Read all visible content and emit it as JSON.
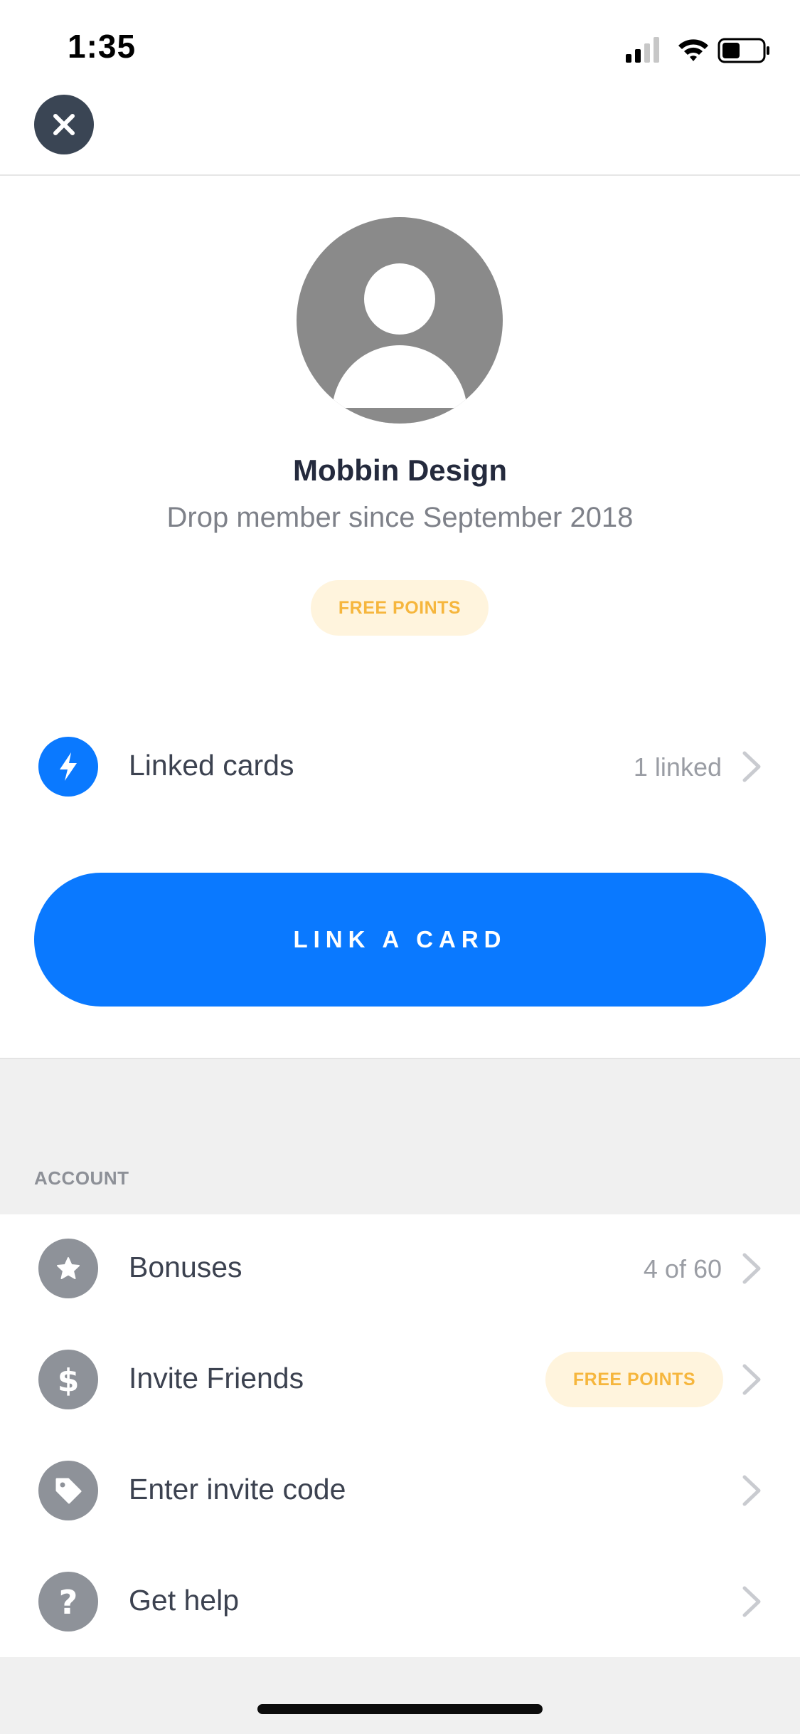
{
  "status_bar": {
    "time": "1:35"
  },
  "profile": {
    "name": "Mobbin Design",
    "member_since": "Drop member since September 2018",
    "badge": "FREE POINTS"
  },
  "linked_cards": {
    "label": "Linked cards",
    "value": "1 linked",
    "icon": "lightning-icon"
  },
  "link_button": {
    "label": "LINK A CARD"
  },
  "account": {
    "section_title": "ACCOUNT",
    "items": [
      {
        "label": "Bonuses",
        "value": "4 of 60",
        "icon": "star-icon"
      },
      {
        "label": "Invite Friends",
        "badge": "FREE POINTS",
        "icon": "dollar-icon"
      },
      {
        "label": "Enter invite code",
        "icon": "tag-icon"
      },
      {
        "label": "Get help",
        "icon": "question-icon"
      }
    ]
  },
  "colors": {
    "accent": "#0a79ff",
    "badge_bg": "#fff4dd",
    "badge_text": "#f6b63d",
    "icon_grey": "#8e9299",
    "close_bg": "#3a4554"
  }
}
